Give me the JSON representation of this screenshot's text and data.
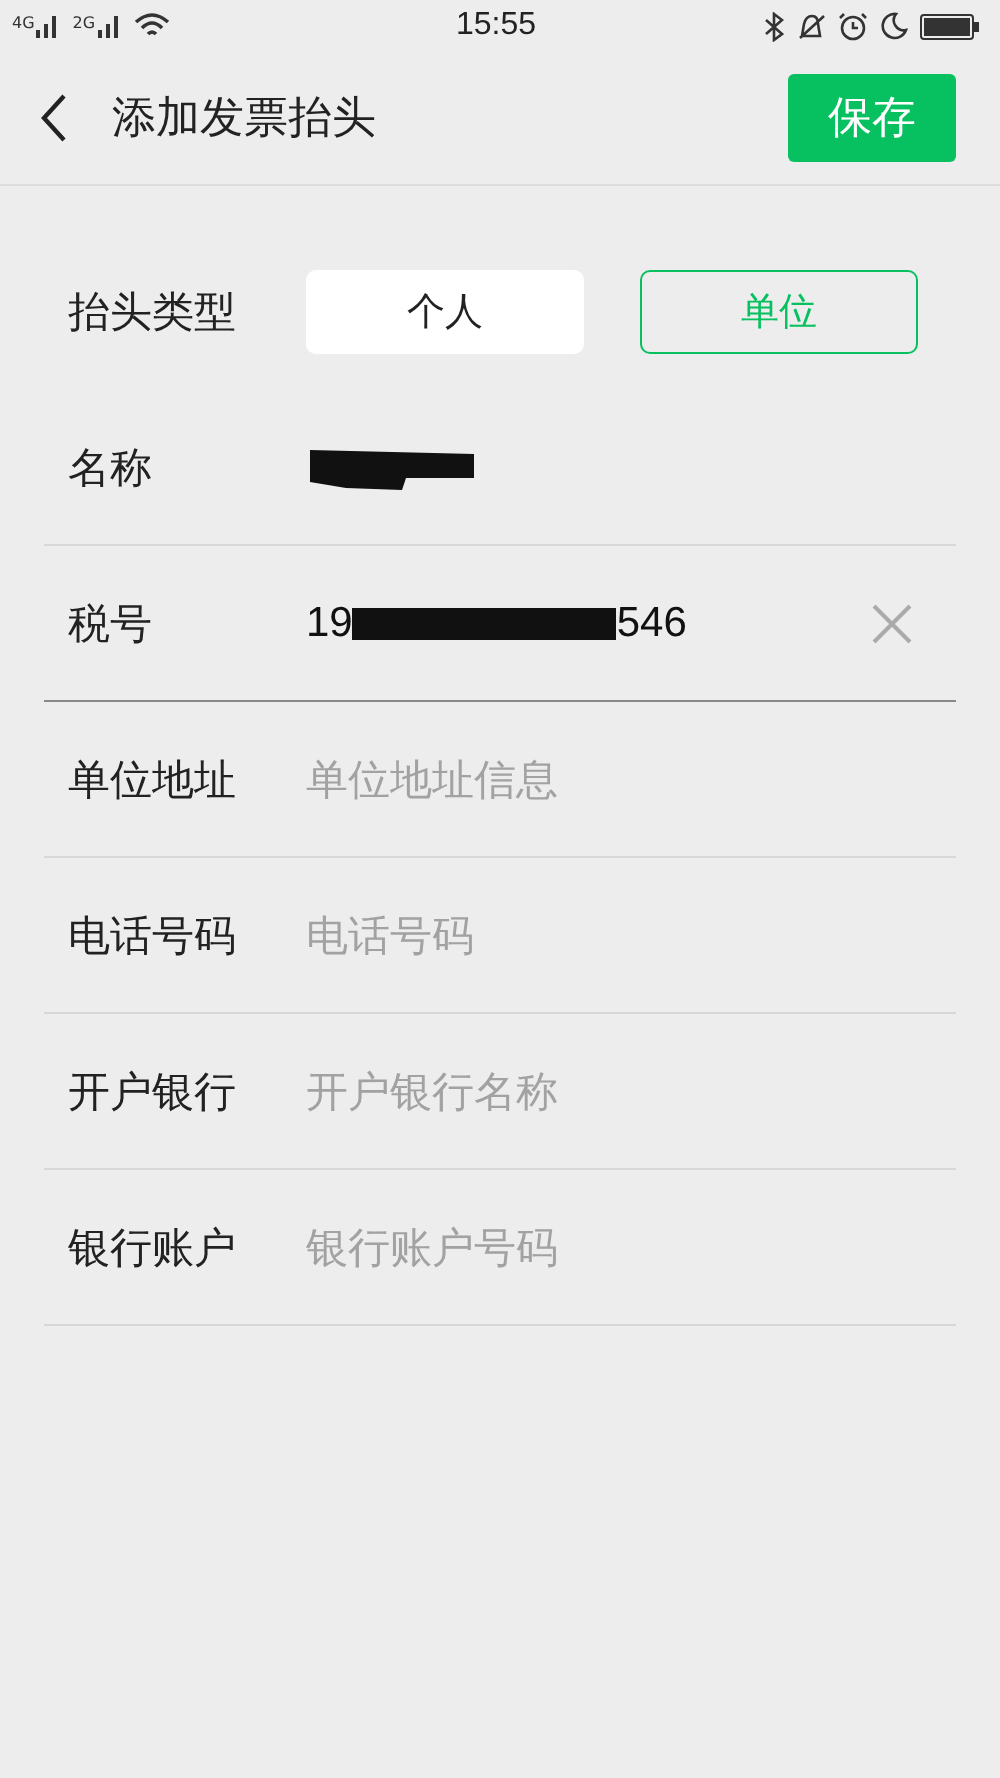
{
  "status_bar": {
    "networks": [
      "4G",
      "2G"
    ],
    "time": "15:55"
  },
  "header": {
    "title": "添加发票抬头",
    "save_button": "保存"
  },
  "type_row": {
    "label": "抬头类型",
    "options": [
      {
        "label": "个人",
        "selected": false
      },
      {
        "label": "单位",
        "selected": true
      }
    ]
  },
  "fields": [
    {
      "label": "名称",
      "kind": "redacted",
      "focused": false
    },
    {
      "label": "税号",
      "kind": "partial",
      "value_start": "19",
      "value_end": "546",
      "focused": true,
      "clearable": true
    },
    {
      "label": "单位地址",
      "kind": "input",
      "placeholder": "单位地址信息",
      "focused": false
    },
    {
      "label": "电话号码",
      "kind": "input",
      "placeholder": "电话号码",
      "focused": false
    },
    {
      "label": "开户银行",
      "kind": "input",
      "placeholder": "开户银行名称",
      "focused": false
    },
    {
      "label": "银行账户",
      "kind": "input",
      "placeholder": "银行账户号码",
      "focused": false
    }
  ]
}
